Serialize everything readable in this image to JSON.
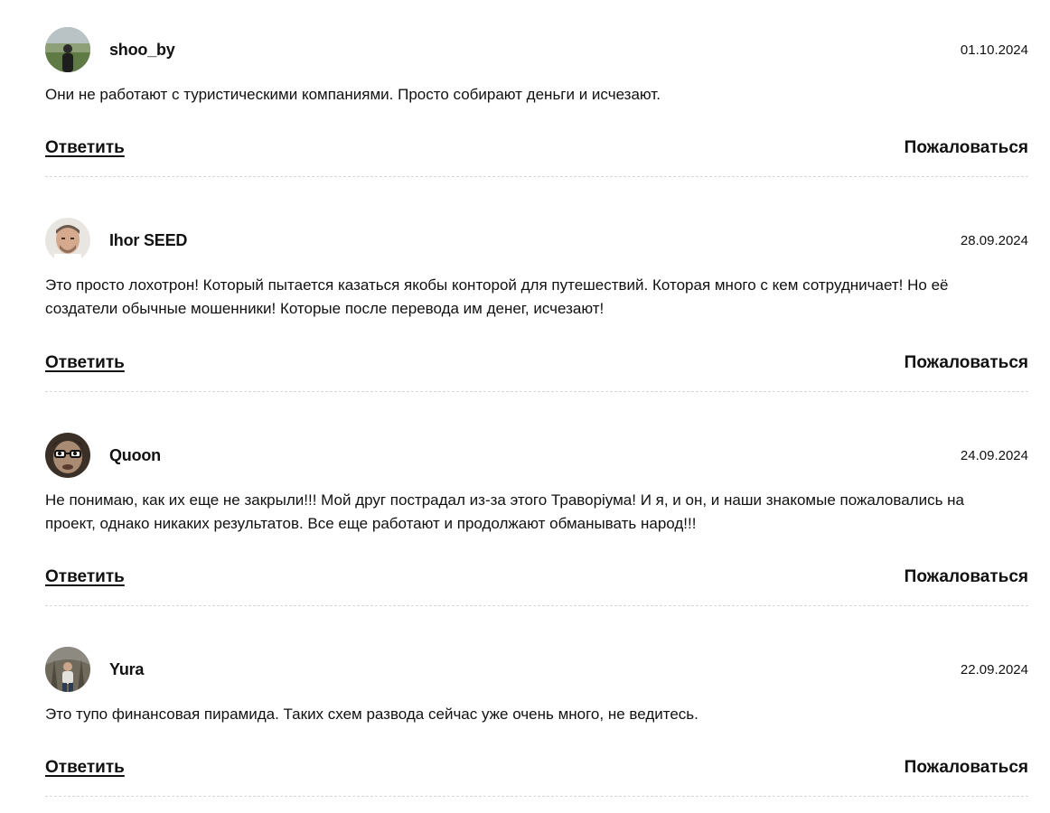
{
  "comments": [
    {
      "author": "shoo_by",
      "date": "01.10.2024",
      "text": "Они не работают с туристическими компаниями. Просто собирают деньги и исчезают.",
      "reply_label": "Ответить",
      "report_label": "Пожаловаться"
    },
    {
      "author": "Ihor SEED",
      "date": "28.09.2024",
      "text": "Это просто лохотрон! Который пытается казаться якобы конторой для путешествий. Которая много с кем сотрудничает! Но её создатели обычные мошенники! Которые после перевода им денег, исчезают!",
      "reply_label": "Ответить",
      "report_label": "Пожаловаться"
    },
    {
      "author": "Quoon",
      "date": "24.09.2024",
      "text": "Не понимаю, как их еще не закрыли!!! Мой друг пострадал из-за этого Траворіума! И я, и он, и наши знакомые пожаловались на проект, однако никаких результатов. Все еще работают и продолжают обманывать народ!!!",
      "reply_label": "Ответить",
      "report_label": "Пожаловаться"
    },
    {
      "author": "Yura",
      "date": "22.09.2024",
      "text": "Это тупо финансовая пирамида. Таких схем развода сейчас уже очень много, не ведитесь.",
      "reply_label": "Ответить",
      "report_label": "Пожаловаться"
    }
  ]
}
